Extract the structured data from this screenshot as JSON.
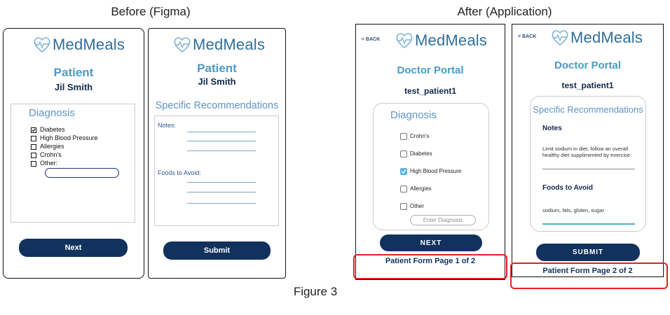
{
  "headings": {
    "before": "Before (Figma)",
    "after": "After (Application)",
    "figure": "Figure 3"
  },
  "brand": {
    "name": "MedMeals"
  },
  "figma1": {
    "title": "Patient",
    "patient_name": "Jil Smith",
    "card_title": "Diagnosis",
    "options": [
      {
        "label": "Diabetes",
        "checked": true
      },
      {
        "label": "High Blood Pressure",
        "checked": false
      },
      {
        "label": "Allergies",
        "checked": false
      },
      {
        "label": "Crohn's",
        "checked": false
      },
      {
        "label": "Other:",
        "checked": false
      }
    ],
    "button": "Next"
  },
  "figma2": {
    "title": "Patient",
    "patient_name": "Jil Smith",
    "card_title": "Specific Recommendations",
    "notes_label": "Notes:",
    "foods_label": "Foods to Avoid:",
    "button": "Submit"
  },
  "app1": {
    "back": "< BACK",
    "title": "Doctor Portal",
    "patient_name": "test_patient1",
    "card_title": "Diagnosis",
    "options": [
      {
        "label": "Crohn's",
        "checked": false
      },
      {
        "label": "Diabetes",
        "checked": false
      },
      {
        "label": "High Blood Pressure",
        "checked": true
      },
      {
        "label": "Allergies",
        "checked": false
      },
      {
        "label": "Other",
        "checked": false
      }
    ],
    "diagnosis_placeholder": "Enter Diagnosis",
    "button": "NEXT",
    "footer": "Patient Form Page 1 of 2"
  },
  "app2": {
    "back": "< BACK",
    "title": "Doctor Portal",
    "patient_name": "test_patient1",
    "card_title": "Specific Recommendations",
    "notes_label": "Notes",
    "notes_value": "Limit sodium in diet, follow an overall healthy diet supplimented by exercise.",
    "foods_label": "Foods to Avoid",
    "foods_value": "sodium, fats, gluten, sugar",
    "button": "SUBMIT",
    "footer": "Patient Form Page 2 of 2"
  },
  "colors": {
    "navy": "#10325d",
    "teal": "#4a9bc4",
    "highlight": "#e1201f",
    "check": "#5fb6dc"
  }
}
